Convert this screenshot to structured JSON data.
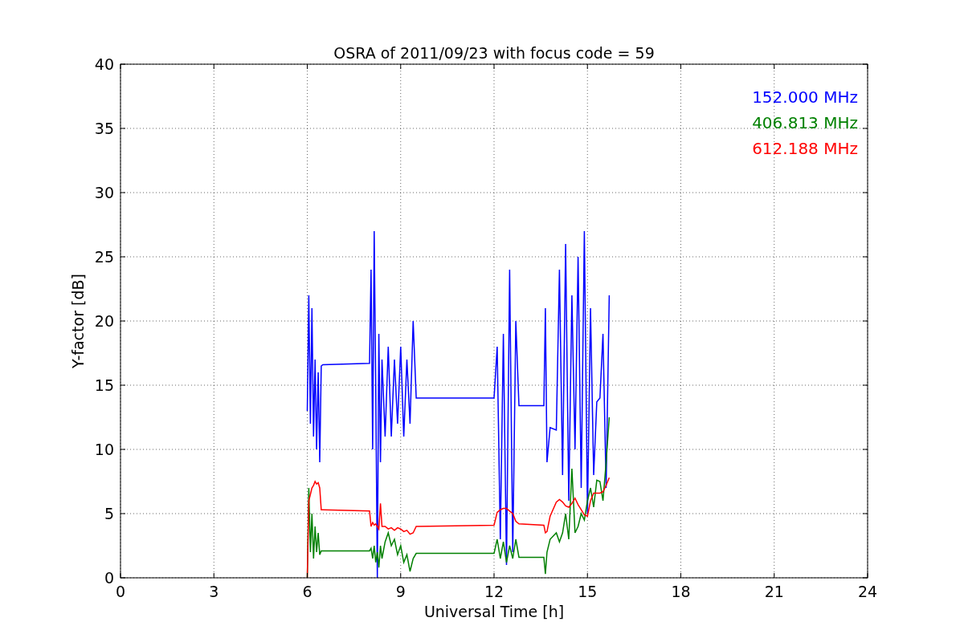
{
  "chart_data": {
    "type": "line",
    "grid": true,
    "title": "OSRA of 2011/09/23 with focus code = 59",
    "xlabel": "Universal Time [h]",
    "ylabel": "Y-factor [dB]",
    "xlim": [
      0,
      24
    ],
    "ylim": [
      0,
      40
    ],
    "xticks": [
      0,
      3,
      6,
      9,
      12,
      15,
      18,
      21,
      24
    ],
    "yticks": [
      0,
      5,
      10,
      15,
      20,
      25,
      30,
      35,
      40
    ],
    "x": [
      6.0,
      6.05,
      6.1,
      6.15,
      6.2,
      6.25,
      6.3,
      6.35,
      6.4,
      6.45,
      6.5,
      8.0,
      8.05,
      8.1,
      8.15,
      8.2,
      8.25,
      8.3,
      8.35,
      8.4,
      8.5,
      8.6,
      8.7,
      8.8,
      8.9,
      9.0,
      9.1,
      9.2,
      9.3,
      9.4,
      9.5,
      12.0,
      12.1,
      12.2,
      12.3,
      12.4,
      12.5,
      12.6,
      12.7,
      12.8,
      13.6,
      13.65,
      13.7,
      13.8,
      14.0,
      14.1,
      14.2,
      14.3,
      14.4,
      14.5,
      14.6,
      14.7,
      14.8,
      14.9,
      15.0,
      15.1,
      15.2,
      15.3,
      15.4,
      15.5,
      15.6,
      15.7
    ],
    "series": [
      {
        "name": "152.000 MHz",
        "color": "#0000ff",
        "values": [
          13,
          22,
          12,
          21,
          11,
          17,
          10,
          16,
          9,
          16.5,
          16.6,
          16.7,
          24,
          10,
          27,
          15,
          0,
          19,
          9,
          17,
          11,
          18,
          11,
          17,
          12,
          18,
          11,
          17,
          12,
          20,
          14,
          14,
          18,
          3,
          19,
          1,
          24,
          2,
          20,
          13.4,
          13.4,
          21,
          9,
          11.7,
          11.5,
          24,
          8,
          26,
          6,
          22,
          10,
          25,
          7,
          27,
          5,
          21,
          8,
          13.7,
          14,
          19,
          7,
          22
        ]
      },
      {
        "name": "406.813 MHz",
        "color": "#008000",
        "values": [
          0,
          7,
          2,
          5,
          1.5,
          4,
          2,
          3.5,
          1.8,
          2.1,
          2.1,
          2.1,
          2.3,
          1.5,
          2.5,
          1.2,
          2,
          0.8,
          2.5,
          1.5,
          2.8,
          3.5,
          2.5,
          3,
          1.8,
          2.5,
          1.2,
          1.8,
          0.5,
          1.5,
          1.9,
          1.9,
          3,
          1.5,
          2.8,
          1.2,
          2.5,
          1.5,
          3,
          1.6,
          1.6,
          0.3,
          2,
          3,
          3.5,
          2.8,
          3.5,
          5,
          3,
          8.5,
          3.5,
          4,
          5,
          4.5,
          6,
          7,
          5.5,
          7.6,
          7.5,
          6,
          9,
          12.5
        ]
      },
      {
        "name": "612.188 MHz",
        "color": "#ff0000",
        "values": [
          0,
          6,
          6.5,
          7,
          7.2,
          7.5,
          7.3,
          7.4,
          7,
          5.3,
          5.3,
          5.2,
          4,
          4.3,
          4.1,
          4.2,
          4,
          3.8,
          5.8,
          4,
          4,
          3.8,
          3.9,
          3.7,
          3.9,
          3.8,
          3.6,
          3.7,
          3.4,
          3.5,
          4.0,
          4.1,
          5.1,
          5.3,
          5.4,
          5.4,
          5.2,
          5,
          4.4,
          4.2,
          4.1,
          3.5,
          3.6,
          4.8,
          5.9,
          6.1,
          5.9,
          5.6,
          5.5,
          5.8,
          6.2,
          5.7,
          5.3,
          4.9,
          4.8,
          6,
          6.6,
          6.6,
          6.6,
          6.7,
          7.2,
          7.8
        ]
      }
    ]
  }
}
